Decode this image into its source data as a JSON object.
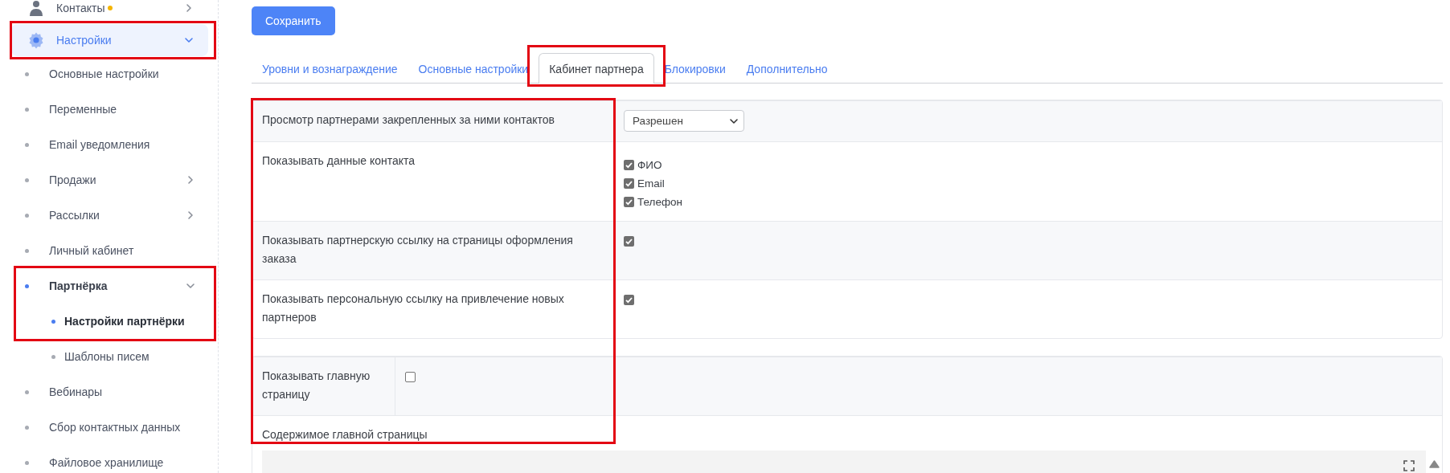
{
  "sidebar": {
    "items": [
      {
        "label": "Контакты",
        "expanded": false,
        "notice_dot": true,
        "annotated": false,
        "selected": false
      },
      {
        "label": "Настройки",
        "expanded": true,
        "notice_dot": false,
        "annotated": true,
        "selected": true,
        "children": [
          {
            "label": "Основные настройки",
            "selected": false
          },
          {
            "label": "Переменные",
            "selected": false
          },
          {
            "label": "Email уведомления",
            "selected": false
          },
          {
            "label": "Продажи",
            "selected": false,
            "expanded": false
          },
          {
            "label": "Рассылки",
            "selected": false,
            "expanded": false
          },
          {
            "label": "Личный кабинет",
            "selected": false
          },
          {
            "label": "Партнёрка",
            "selected": false,
            "expanded": true,
            "annotated": true,
            "children": [
              {
                "label": "Настройки партнёрки",
                "selected": true
              },
              {
                "label": "Шаблоны писем",
                "selected": false
              }
            ]
          },
          {
            "label": "Вебинары",
            "selected": false
          },
          {
            "label": "Сбор контактных данных",
            "selected": false
          },
          {
            "label": "Файловое хранилище",
            "selected": false
          }
        ]
      }
    ]
  },
  "save_button": "Сохранить",
  "tabs": [
    {
      "label": "Уровни и вознаграждение",
      "selected": false,
      "annotated": false
    },
    {
      "label": "Основные настройки",
      "selected": false,
      "annotated": false
    },
    {
      "label": "Кабинет партнера",
      "selected": true,
      "annotated": true
    },
    {
      "label": "Блокировки",
      "selected": false,
      "annotated": false
    },
    {
      "label": "Дополнительно",
      "selected": false,
      "annotated": false
    }
  ],
  "labels_annotated": true,
  "sections": [
    {
      "rows": [
        {
          "label": "Просмотр партнерами закрепленных за ними контактов",
          "kind": "select",
          "value": "Разрешен"
        },
        {
          "label": "Показывать данные контакта",
          "kind": "checklist",
          "options": [
            {
              "label": "ФИО",
              "checked": true
            },
            {
              "label": "Email",
              "checked": true
            },
            {
              "label": "Телефон",
              "checked": true
            }
          ]
        },
        {
          "label": "Показывать партнерскую ссылку на страницы оформления заказа",
          "kind": "checkbox",
          "checked": true
        },
        {
          "label": "Показывать персональную ссылку на привлечение новых партнеров",
          "kind": "checkbox",
          "checked": true
        }
      ]
    },
    {
      "rows": [
        {
          "label": "Показывать главную страницу",
          "kind": "checkbox",
          "checked": false
        },
        {
          "label": "Содержимое главной страницы",
          "kind": "editor"
        }
      ]
    }
  ]
}
